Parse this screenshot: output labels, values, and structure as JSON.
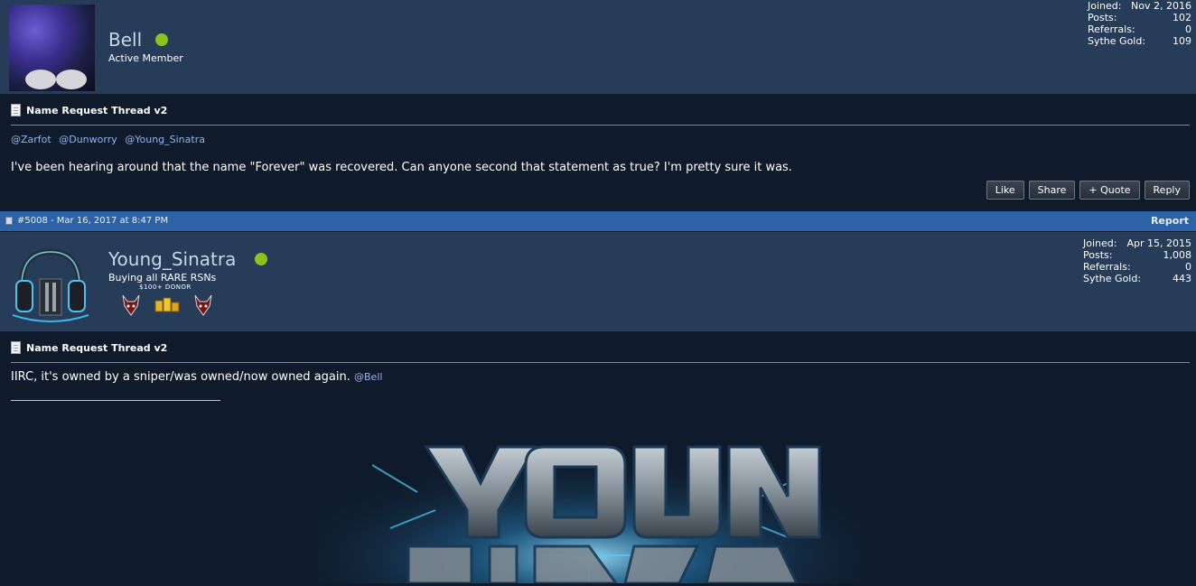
{
  "post1": {
    "username": "Bell",
    "user_title": "Active Member",
    "stats": [
      {
        "label": "Joined:",
        "value": "Nov 2, 2016"
      },
      {
        "label": "Posts:",
        "value": "102"
      },
      {
        "label": "Referrals:",
        "value": "0"
      },
      {
        "label": "Sythe Gold:",
        "value": "109"
      }
    ],
    "thread_title": "Name Request Thread v2",
    "mentions": [
      "@Zarfot",
      "@Dunworry",
      "@Young_Sinatra"
    ],
    "message": "I've been hearing around that the name \"Forever\" was recovered. Can anyone second that statement as true? I'm pretty sure it was.",
    "buttons": {
      "like": "Like",
      "share": "Share",
      "quote": "+ Quote",
      "reply": "Reply"
    }
  },
  "post_bar": {
    "post_info": "#5008 - Mar 16, 2017 at 8:47 PM",
    "report": "Report"
  },
  "post2": {
    "username": "Young_Sinatra",
    "user_title": "Buying all RARE RSNs",
    "donor_label": "$100+ DONOR",
    "stats": [
      {
        "label": "Joined:",
        "value": "Apr 15, 2015"
      },
      {
        "label": "Posts:",
        "value": "1,008"
      },
      {
        "label": "Referrals:",
        "value": "0"
      },
      {
        "label": "Sythe Gold:",
        "value": "443"
      }
    ],
    "thread_title": "Name Request Thread v2",
    "message": "IIRC, it's owned by a sniper/was owned/now owned again.",
    "mention": "@Bell",
    "banner_text": "YOUNG SINATRA"
  },
  "colors": {
    "header_bg": "#263c58",
    "page_bg": "#0f1b2b",
    "post_bar": "#2d62a6",
    "online": "#8bc31d",
    "mention": "#8fb6ee"
  }
}
